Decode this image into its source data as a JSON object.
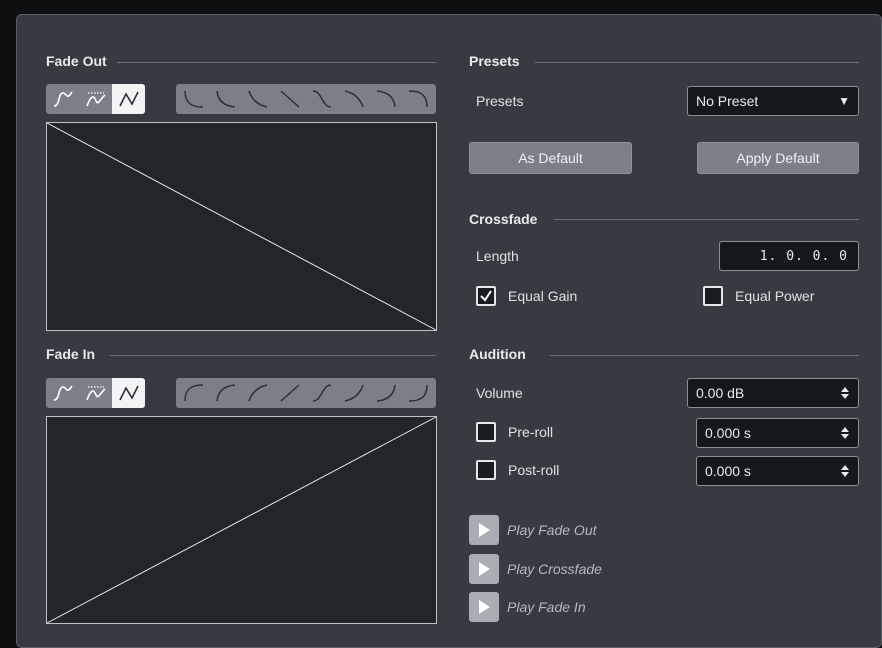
{
  "fade_out": {
    "title": "Fade Out",
    "curve_types": [
      {
        "icon": "spline-curve-icon",
        "active": false
      },
      {
        "icon": "damped-spline-curve-icon",
        "active": false
      },
      {
        "icon": "linear-curve-icon",
        "active": true
      }
    ],
    "shape_presets": [
      "concave-icon",
      "concave-icon",
      "concave-icon",
      "linear-down-icon",
      "s-curve-icon",
      "convex-icon",
      "convex-icon",
      "convex-icon"
    ]
  },
  "fade_in": {
    "title": "Fade In",
    "curve_types": [
      {
        "icon": "spline-curve-icon",
        "active": false
      },
      {
        "icon": "damped-spline-curve-icon",
        "active": false
      },
      {
        "icon": "linear-curve-icon",
        "active": true
      }
    ],
    "shape_presets": [
      "convex-icon",
      "convex-icon",
      "convex-icon",
      "linear-up-icon",
      "s-curve-icon",
      "concave-icon",
      "concave-icon",
      "concave-icon"
    ]
  },
  "presets": {
    "title": "Presets",
    "label": "Presets",
    "selected": "No Preset",
    "as_default_label": "As Default",
    "apply_default_label": "Apply Default"
  },
  "crossfade": {
    "title": "Crossfade",
    "length_label": "Length",
    "length_value": "1. 0. 0.  0",
    "equal_gain_label": "Equal Gain",
    "equal_gain_checked": true,
    "equal_power_label": "Equal Power",
    "equal_power_checked": false
  },
  "audition": {
    "title": "Audition",
    "volume_label": "Volume",
    "volume_value": "0.00 dB",
    "preroll_label": "Pre-roll",
    "preroll_checked": false,
    "preroll_value": "0.000 s",
    "postroll_label": "Post-roll",
    "postroll_checked": false,
    "postroll_value": "0.000 s",
    "play_fade_out": "Play Fade Out",
    "play_crossfade": "Play Crossfade",
    "play_fade_in": "Play Fade In"
  },
  "colors": {
    "panel": "#363b42",
    "graph_bg": "#22262b",
    "button": "#7b8088",
    "active_button": "#f2f3f5"
  }
}
